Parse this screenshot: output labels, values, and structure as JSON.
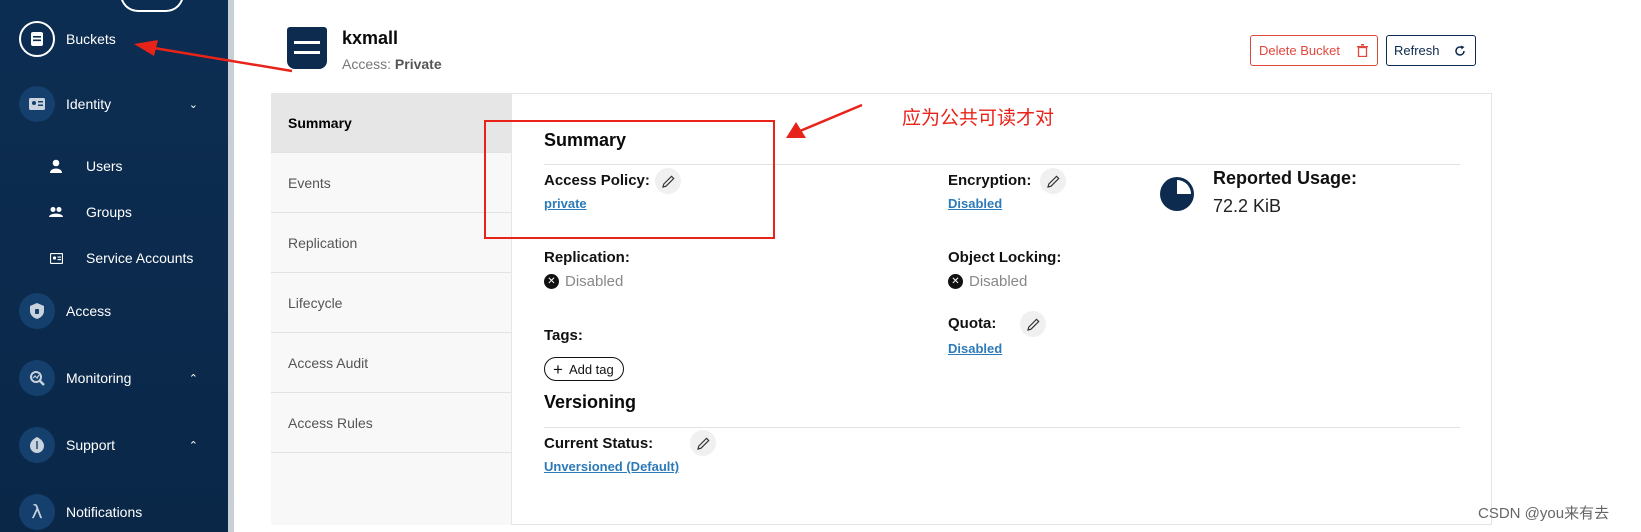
{
  "sidebar": {
    "items": [
      {
        "label": "Buckets",
        "icon": "bucket-icon"
      },
      {
        "label": "Identity",
        "icon": "id-card-icon"
      },
      {
        "label": "Users",
        "icon": "user-icon"
      },
      {
        "label": "Groups",
        "icon": "group-icon"
      },
      {
        "label": "Service Accounts",
        "icon": "badge-icon"
      },
      {
        "label": "Access",
        "icon": "shield-icon"
      },
      {
        "label": "Monitoring",
        "icon": "monitor-search-icon"
      },
      {
        "label": "Support",
        "icon": "support-icon"
      },
      {
        "label": "Notifications",
        "icon": "lambda-icon"
      }
    ]
  },
  "header": {
    "bucket_name": "kxmall",
    "access_prefix": "Access:",
    "access_value": "Private",
    "delete_label": "Delete Bucket",
    "refresh_label": "Refresh"
  },
  "tabs": [
    "Summary",
    "Events",
    "Replication",
    "Lifecycle",
    "Access Audit",
    "Access Rules"
  ],
  "summary": {
    "title": "Summary",
    "access_policy_label": "Access Policy:",
    "access_policy_value": "private",
    "encryption_label": "Encryption:",
    "encryption_value": "Disabled",
    "reported_usage_label": "Reported Usage:",
    "reported_usage_value": "72.2 KiB",
    "replication_label": "Replication:",
    "replication_value": "Disabled",
    "object_locking_label": "Object Locking:",
    "object_locking_value": "Disabled",
    "quota_label": "Quota:",
    "quota_value": "Disabled",
    "tags_label": "Tags:",
    "add_tag_label": "Add tag"
  },
  "versioning": {
    "title": "Versioning",
    "current_status_label": "Current Status:",
    "current_status_value": "Unversioned (Default)"
  },
  "annotation": {
    "note": "应为公共可读才对"
  },
  "watermark": "CSDN @you来有去",
  "colors": {
    "sidebar": "#0c2d52",
    "accent_red": "#e8231a",
    "link": "#2d7ab8",
    "delete": "#e0473d"
  }
}
